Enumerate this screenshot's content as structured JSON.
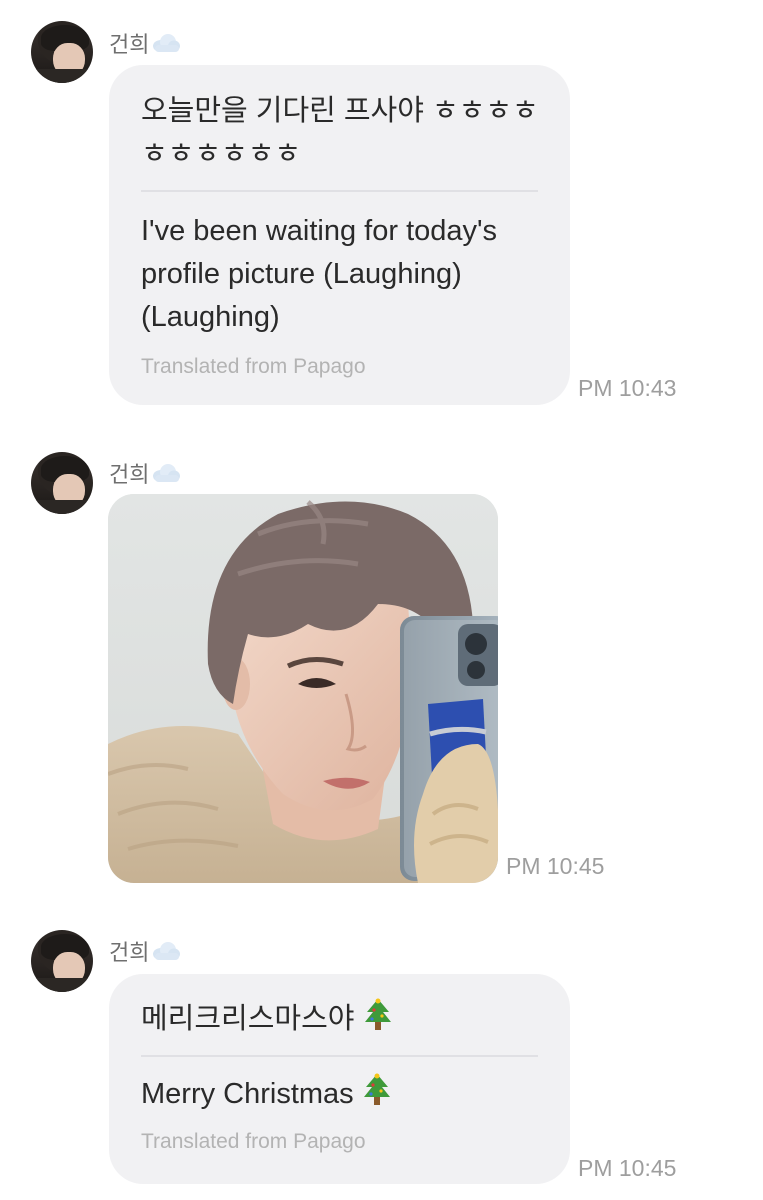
{
  "messages": [
    {
      "sender": "건희",
      "original": "오늘만을 기다린 프사야 ㅎㅎㅎㅎㅎㅎㅎㅎㅎㅎ",
      "translation": "I've been waiting for today's profile picture (Laughing) (Laughing)",
      "translated_label": "Translated from Papago",
      "time": "PM 10:43"
    },
    {
      "sender": "건희",
      "image_icon": "selfie-photo",
      "time": "PM 10:45"
    },
    {
      "sender": "건희",
      "original": "메리크리스마스야",
      "original_emoji": "christmas-tree-icon",
      "translation": "Merry Christmas",
      "translation_emoji": "christmas-tree-icon",
      "translated_label": "Translated from Papago",
      "time": "PM 10:45"
    }
  ],
  "colors": {
    "bubble": "#f1f1f3",
    "time": "#9e9e9e",
    "sender": "#6f6f6f",
    "translated_label": "#b3b3b3"
  }
}
